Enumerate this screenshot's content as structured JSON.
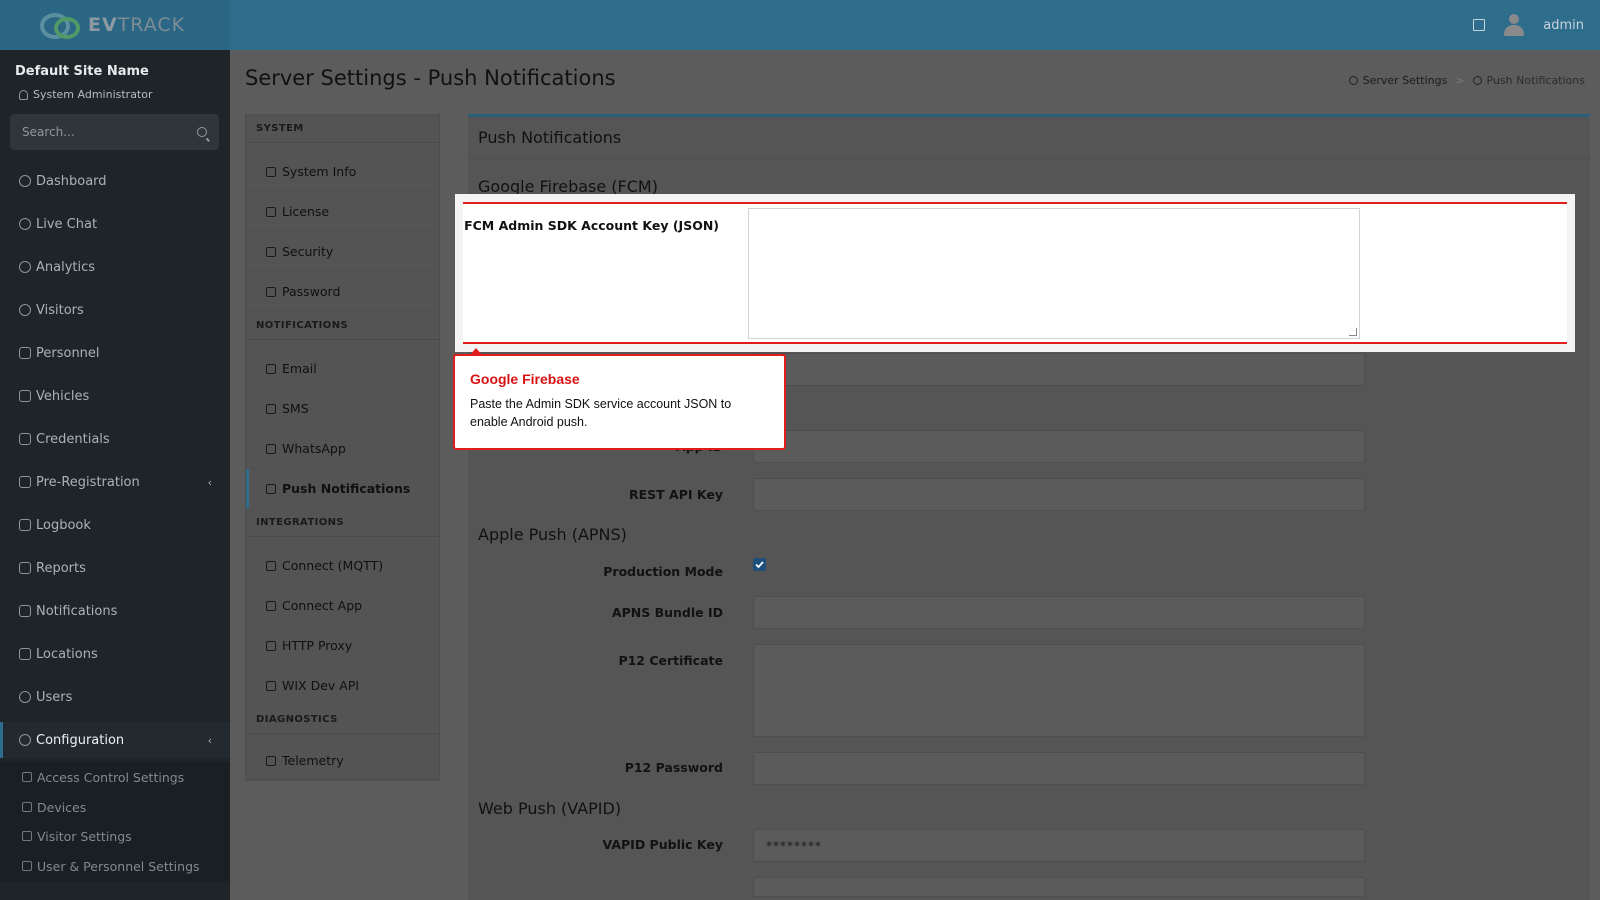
{
  "brand": {
    "name_bold": "EV",
    "name_rest": "TRACK"
  },
  "topbar": {
    "user": "admin"
  },
  "sidebar": {
    "site_name": "Default Site Name",
    "role": "System Administrator",
    "search_placeholder": "Search...",
    "items": [
      {
        "label": "Dashboard",
        "icon": "dashboard-icon"
      },
      {
        "label": "Live Chat",
        "icon": "headset-icon"
      },
      {
        "label": "Analytics",
        "icon": "target-icon"
      },
      {
        "label": "Visitors",
        "icon": "eye-icon"
      },
      {
        "label": "Personnel",
        "icon": "user-badge-icon"
      },
      {
        "label": "Vehicles",
        "icon": "car-icon"
      },
      {
        "label": "Credentials",
        "icon": "id-card-icon"
      },
      {
        "label": "Pre-Registration",
        "icon": "arrows-icon",
        "chevron": "‹"
      },
      {
        "label": "Logbook",
        "icon": "book-icon"
      },
      {
        "label": "Reports",
        "icon": "chart-icon"
      },
      {
        "label": "Notifications",
        "icon": "chat-icon"
      },
      {
        "label": "Locations",
        "icon": "building-icon"
      },
      {
        "label": "Users",
        "icon": "users-icon"
      },
      {
        "label": "Configuration",
        "icon": "gear-icon",
        "chevron": "‹"
      }
    ],
    "sub_items": [
      {
        "label": "Access Control Settings",
        "icon": "lock-icon"
      },
      {
        "label": "Devices",
        "icon": "gear-icon"
      },
      {
        "label": "Visitor Settings",
        "icon": "eye-icon"
      },
      {
        "label": "User & Personnel Settings",
        "icon": "users-icon"
      }
    ]
  },
  "page": {
    "title": "Server Settings - Push Notifications",
    "breadcrumb": [
      "Server Settings",
      ">",
      "Push Notifications"
    ]
  },
  "settings_menu": {
    "system_header": "SYSTEM",
    "system": [
      "System Info",
      "License",
      "Security",
      "Password"
    ],
    "notifications_header": "NOTIFICATIONS",
    "notifications": [
      "Email",
      "SMS",
      "WhatsApp",
      "Push Notifications"
    ],
    "integrations_header": "INTEGRATIONS",
    "integrations": [
      "Connect (MQTT)",
      "Connect App",
      "HTTP Proxy",
      "WIX Dev API"
    ],
    "diagnostics_header": "DIAGNOSTICS",
    "diagnostics": [
      "Telemetry"
    ]
  },
  "panel": {
    "title": "Push Notifications",
    "fcm_title": "Google Firebase (FCM)",
    "fcm_key_label": "FCM Admin SDK Account Key (JSON)",
    "app_id_label": "App ID",
    "rest_api_label": "REST API Key",
    "apns_title": "Apple Push (APNS)",
    "production_label": "Production Mode",
    "production_checked": true,
    "bundle_label": "APNS Bundle ID",
    "p12_cert_label": "P12 Certificate",
    "p12_password_label": "P12 Password",
    "vapid_title": "Web Push (VAPID)",
    "vapid_public_label": "VAPID Public Key",
    "vapid_public_value": "********"
  },
  "tooltip": {
    "title": "Google Firebase",
    "body": "Paste the Admin SDK service account JSON to enable Android push."
  },
  "colors": {
    "accent": "#2f6d8d",
    "highlight": "#e11d1d"
  }
}
